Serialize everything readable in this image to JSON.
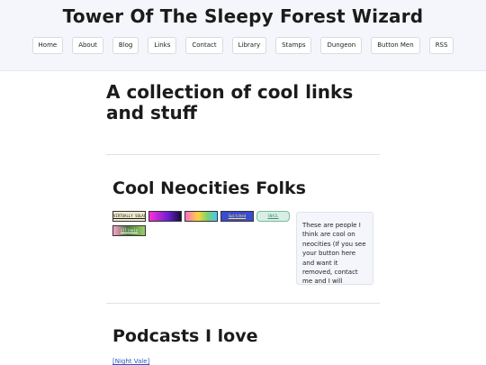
{
  "site": {
    "title": "Tower Of The Sleepy Forest Wizard"
  },
  "nav": [
    {
      "label": "Home"
    },
    {
      "label": "About"
    },
    {
      "label": "Blog"
    },
    {
      "label": "Links"
    },
    {
      "label": "Contact"
    },
    {
      "label": "Library"
    },
    {
      "label": "Stamps"
    },
    {
      "label": "Dungeon"
    },
    {
      "label": "Button Men"
    },
    {
      "label": "RSS"
    }
  ],
  "main": {
    "heading": "A collection of cool links and stuff",
    "neocities": {
      "title": "Cool Neocities Folks",
      "buttons": [
        {
          "text": "VIRTUALLY SOLACED"
        },
        {
          "text": ""
        },
        {
          "text": ""
        },
        {
          "text": "Switched"
        },
        {
          "text": "SNAIL"
        },
        {
          "text": "illinois"
        }
      ],
      "aside": "These are people I think are cool on neocities (If you see your button here and want it removed, contact me and I will"
    },
    "podcasts": {
      "title": "Podcasts I love",
      "links": [
        {
          "label": "[Night Vale]"
        }
      ]
    }
  },
  "colors": {
    "header_bg": "#f4f6fb",
    "link": "#2a56c6",
    "divider": "#dfe2e8"
  }
}
